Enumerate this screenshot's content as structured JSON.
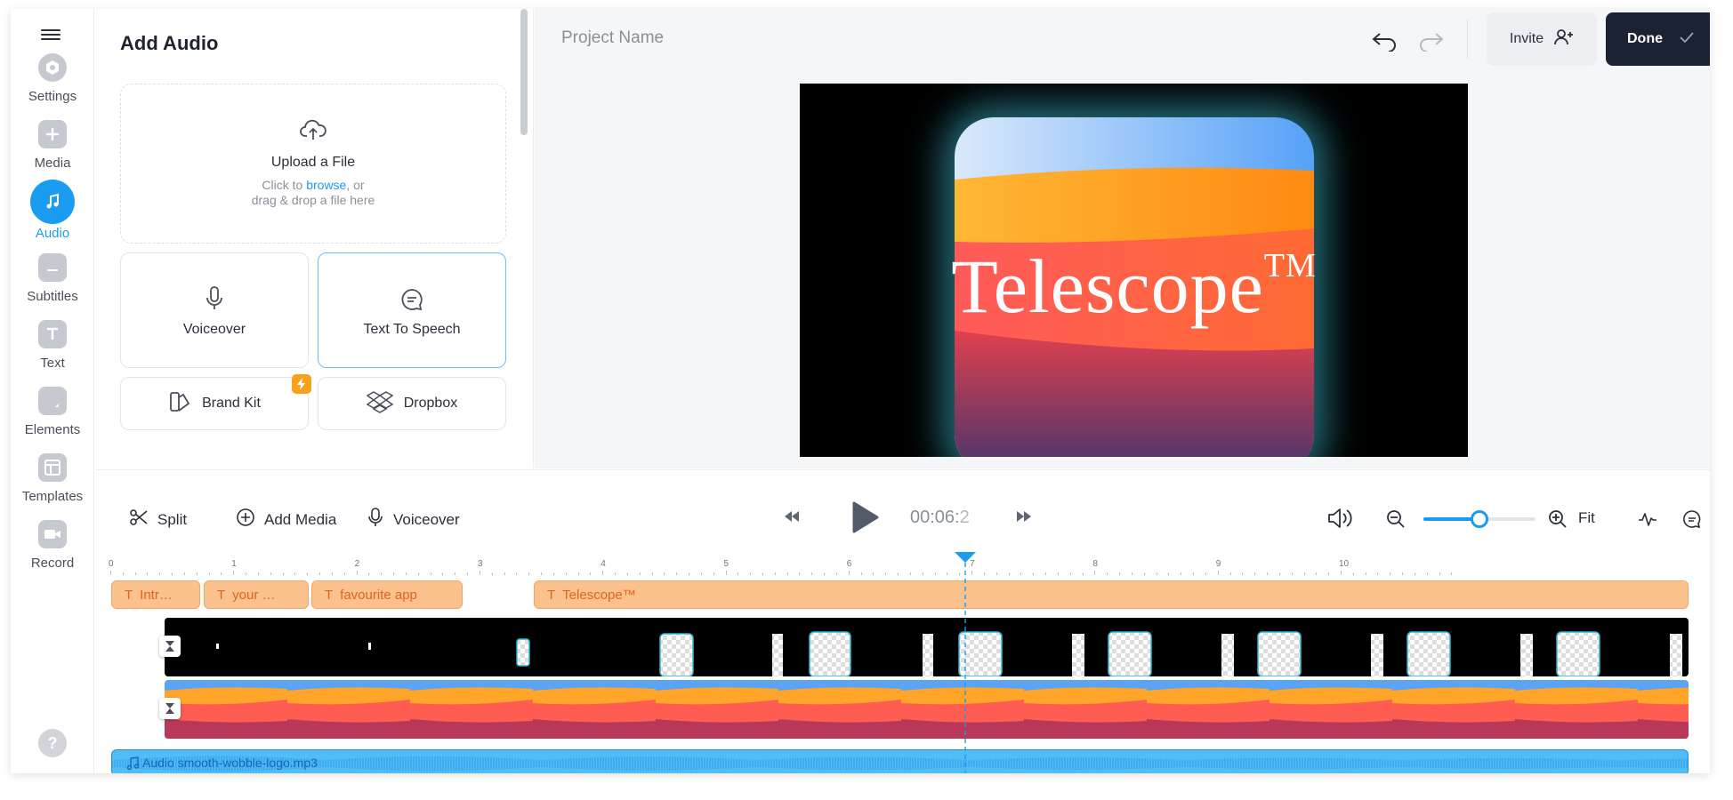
{
  "sidebar": {
    "items": [
      {
        "label": "Settings",
        "icon": "gear-icon"
      },
      {
        "label": "Media",
        "icon": "plus-icon"
      },
      {
        "label": "Audio",
        "icon": "music-note-icon",
        "active": true
      },
      {
        "label": "Subtitles",
        "icon": "subtitles-icon"
      },
      {
        "label": "Text",
        "icon": "text-icon"
      },
      {
        "label": "Elements",
        "icon": "elements-icon"
      },
      {
        "label": "Templates",
        "icon": "templates-icon"
      },
      {
        "label": "Record",
        "icon": "camera-icon"
      }
    ],
    "help": "?"
  },
  "panel": {
    "title": "Add Audio",
    "upload": {
      "title": "Upload a File",
      "line1_prefix": "Click to ",
      "line1_link": "browse",
      "line1_suffix": ", or",
      "line2": "drag & drop a file here"
    },
    "tiles": {
      "voiceover": "Voiceover",
      "tts": "Text To Speech",
      "brandkit": "Brand Kit",
      "dropbox": "Dropbox"
    }
  },
  "header": {
    "project_name": "Project Name",
    "invite": "Invite",
    "done": "Done"
  },
  "preview": {
    "title": "Telescope",
    "trademark": "TM"
  },
  "toolbar": {
    "split": "Split",
    "add_media": "Add Media",
    "voiceover": "Voiceover",
    "timecode_main": "00:06:",
    "timecode_frac": "2",
    "fit": "Fit",
    "zoom_level": 0.5
  },
  "ruler": {
    "labels": [
      "0",
      "1",
      "2",
      "3",
      "4",
      "5",
      "6",
      "7",
      "8",
      "9",
      "10"
    ]
  },
  "tracks": {
    "text_clips": [
      "Intr…",
      "your …",
      "favourite app",
      "Telescope™"
    ],
    "audio_label": "Audio smooth-wobble-logo.mp3"
  },
  "colors": {
    "accent": "#1a9df0",
    "done_bg": "#1b2233",
    "text_clip": "#fcc28d",
    "audio": "#52bcf7"
  }
}
